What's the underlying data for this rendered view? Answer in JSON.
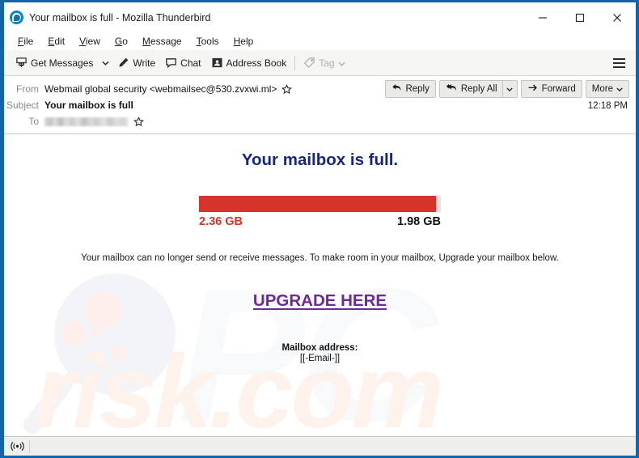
{
  "window": {
    "title": "Your mailbox is full - Mozilla Thunderbird",
    "app_icon": "thunderbird-icon",
    "frame_color": "#1464ac",
    "controls": {
      "minimize": "minimize-icon",
      "maximize": "maximize-icon",
      "close": "close-icon"
    }
  },
  "menubar": {
    "items": [
      {
        "label": "File",
        "accel": "F"
      },
      {
        "label": "Edit",
        "accel": "E"
      },
      {
        "label": "View",
        "accel": "V"
      },
      {
        "label": "Go",
        "accel": "G"
      },
      {
        "label": "Message",
        "accel": "M"
      },
      {
        "label": "Tools",
        "accel": "T"
      },
      {
        "label": "Help",
        "accel": "H"
      }
    ]
  },
  "toolbar": {
    "get_messages_label": "Get Messages",
    "get_messages_icon": "inbox-download-icon",
    "get_messages_dropdown_icon": "chevron-down-icon",
    "write_label": "Write",
    "write_icon": "pencil-icon",
    "chat_label": "Chat",
    "chat_icon": "speech-bubble-icon",
    "address_book_label": "Address Book",
    "address_book_icon": "contact-card-icon",
    "tag_label": "Tag",
    "tag_icon": "tag-icon",
    "tag_dropdown_icon": "chevron-down-icon",
    "tag_disabled": true,
    "app_menu_icon": "hamburger-menu-icon"
  },
  "message_header": {
    "from_label": "From",
    "from_value": "Webmail global security <webmailsec@530.zvxwi.ml>",
    "subject_label": "Subject",
    "subject_value": "Your mailbox is full",
    "to_label": "To",
    "to_value": "",
    "to_redacted": true,
    "star_icon": "star-outline-icon",
    "timestamp": "12:18 PM",
    "actions": {
      "reply_label": "Reply",
      "reply_icon": "reply-arrow-icon",
      "reply_all_label": "Reply All",
      "reply_all_icon": "reply-all-arrow-icon",
      "reply_all_dropdown_icon": "chevron-down-icon",
      "forward_label": "Forward",
      "forward_icon": "forward-arrow-icon",
      "more_label": "More",
      "more_dropdown_icon": "chevron-down-icon"
    }
  },
  "email_body": {
    "heading": "Your mailbox is full.",
    "heading_color": "#17277f",
    "gauge": {
      "used_label": "2.36 GB",
      "total_label": "1.98 GB",
      "fill_percent": 98,
      "fill_color": "#d6342b",
      "track_color": "#e3e3e3",
      "used_text_color": "#d6342b",
      "total_text_color": "#111111"
    },
    "paragraph": "Your mailbox can no longer send or receive messages. To make room in your mailbox, Upgrade your mailbox below.",
    "cta_label": "UPGRADE HERE",
    "cta_color": "#6c2b97",
    "address_label": "Mailbox address:",
    "address_value": "[[-Email-]]",
    "watermark": {
      "logo_icon": "magnifying-glass-watermark",
      "text_top": "PC",
      "text_bottom": "risk.com"
    }
  },
  "statusbar": {
    "online_icon": "broadcast-online-icon",
    "text": ""
  }
}
